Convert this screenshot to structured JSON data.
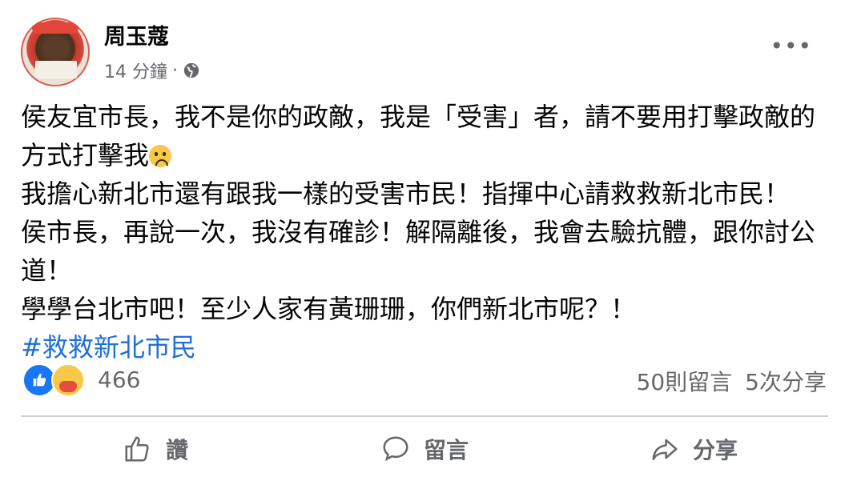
{
  "post": {
    "author": "周玉蔻",
    "time": "14 分鐘",
    "separator": "·",
    "privacy_icon": "globe-icon",
    "more_icon": "more-options-icon",
    "paragraphs": [
      "侯友宜市長，我不是你的政敵，我是「受害」者，請不要用打擊政敵的方式打擊我",
      "我擔心新北市還有跟我一樣的受害市民！指揮中心請救救新北市民！",
      "侯市長，再說一次，我沒有確診！解隔離後，我會去驗抗體，跟你討公道！",
      "學學台北市吧！至少人家有黃珊珊，你們新北市呢？！"
    ],
    "sad_emoji": "sad-face-emoji",
    "hashtag": "#救救新北市民"
  },
  "reactions": {
    "icons": [
      "like-reaction-icon",
      "care-reaction-icon"
    ],
    "count": "466",
    "comments": "50則留言",
    "shares": "5次分享"
  },
  "actions": {
    "like_label": "讚",
    "comment_label": "留言",
    "share_label": "分享"
  },
  "colors": {
    "accent": "#1877f2",
    "hashtag": "#216fdb",
    "secondary_text": "#65676b"
  }
}
